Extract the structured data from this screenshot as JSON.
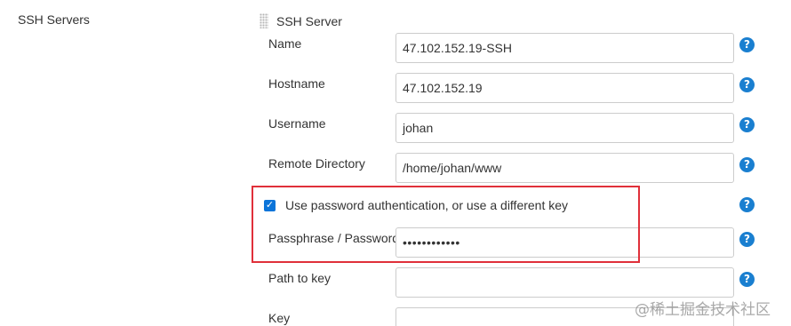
{
  "section": {
    "label": "SSH Servers"
  },
  "server": {
    "title": "SSH Server",
    "fields": {
      "name": {
        "label": "Name",
        "value": "47.102.152.19-SSH"
      },
      "hostname": {
        "label": "Hostname",
        "value": "47.102.152.19"
      },
      "username": {
        "label": "Username",
        "value": "johan"
      },
      "remote_directory": {
        "label": "Remote Directory",
        "value": "/home/johan/www"
      },
      "passphrase": {
        "label": "Passphrase / Password",
        "value": "••••••••••••"
      },
      "path_to_key": {
        "label": "Path to key",
        "value": ""
      },
      "key": {
        "label": "Key",
        "value": ""
      }
    },
    "use_password_auth": {
      "label": "Use password authentication, or use a different key",
      "checked": true
    }
  },
  "help_icon": "?",
  "checkbox_mark": "✓",
  "watermark": "@稀土掘金技术社区",
  "colors": {
    "accent": "#1a7fd0",
    "highlight": "#e0303a",
    "border": "#cccccc"
  }
}
